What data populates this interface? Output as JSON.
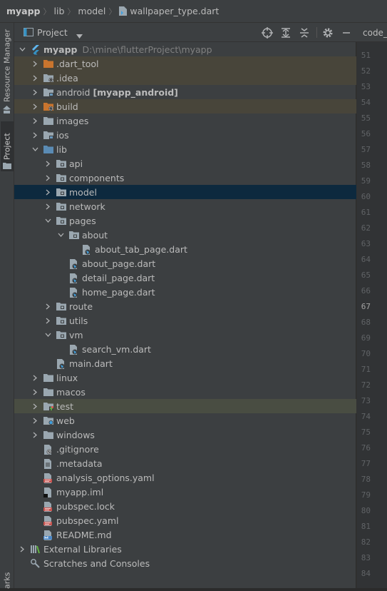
{
  "breadcrumb": {
    "items": [
      "myapp",
      "lib",
      "model",
      "wallpaper_type.dart"
    ]
  },
  "sidebar": {
    "tabs": [
      {
        "label": "Resource Manager"
      },
      {
        "label": "Project"
      },
      {
        "label": "arks"
      }
    ]
  },
  "panel": {
    "title": "Project",
    "icons": [
      "locate-icon",
      "expand-all-icon",
      "collapse-all-icon",
      "gear-icon",
      "minimize-icon"
    ]
  },
  "tree": [
    {
      "label": "myapp",
      "path": "D:\\mine\\flutterProject\\myapp",
      "depth": 0,
      "arrow": "open",
      "icon": "flutter",
      "bold": true
    },
    {
      "label": ".dart_tool",
      "depth": 1,
      "arrow": "closed",
      "icon": "folder-orange",
      "hl": "brown"
    },
    {
      "label": ".idea",
      "depth": 1,
      "arrow": "closed",
      "icon": "folder-gear",
      "hl": "brown"
    },
    {
      "label": "android",
      "suffix": "[myapp_android]",
      "depth": 1,
      "arrow": "closed",
      "icon": "folder-module"
    },
    {
      "label": "build",
      "depth": 1,
      "arrow": "closed",
      "icon": "folder-orange-gear",
      "hl": "brown"
    },
    {
      "label": "images",
      "depth": 1,
      "arrow": "closed",
      "icon": "folder"
    },
    {
      "label": "ios",
      "depth": 1,
      "arrow": "closed",
      "icon": "folder-module"
    },
    {
      "label": "lib",
      "depth": 1,
      "arrow": "open",
      "icon": "folder-blue"
    },
    {
      "label": "api",
      "depth": 2,
      "arrow": "closed",
      "icon": "folder-package"
    },
    {
      "label": "components",
      "depth": 2,
      "arrow": "closed",
      "icon": "folder-package"
    },
    {
      "label": "model",
      "depth": 2,
      "arrow": "closed",
      "icon": "folder-package",
      "hl": "select"
    },
    {
      "label": "network",
      "depth": 2,
      "arrow": "closed",
      "icon": "folder-package"
    },
    {
      "label": "pages",
      "depth": 2,
      "arrow": "open",
      "icon": "folder-package"
    },
    {
      "label": "about",
      "depth": 3,
      "arrow": "open",
      "icon": "folder-package"
    },
    {
      "label": "about_tab_page.dart",
      "depth": 4,
      "arrow": "none",
      "icon": "dart"
    },
    {
      "label": "about_page.dart",
      "depth": 3,
      "arrow": "none",
      "icon": "dart"
    },
    {
      "label": "detail_page.dart",
      "depth": 3,
      "arrow": "none",
      "icon": "dart"
    },
    {
      "label": "home_page.dart",
      "depth": 3,
      "arrow": "none",
      "icon": "dart"
    },
    {
      "label": "route",
      "depth": 2,
      "arrow": "closed",
      "icon": "folder-package"
    },
    {
      "label": "utils",
      "depth": 2,
      "arrow": "closed",
      "icon": "folder-package"
    },
    {
      "label": "vm",
      "depth": 2,
      "arrow": "open",
      "icon": "folder-package"
    },
    {
      "label": "search_vm.dart",
      "depth": 3,
      "arrow": "none",
      "icon": "dart"
    },
    {
      "label": "main.dart",
      "depth": 2,
      "arrow": "none",
      "icon": "dart"
    },
    {
      "label": "linux",
      "depth": 1,
      "arrow": "closed",
      "icon": "folder"
    },
    {
      "label": "macos",
      "depth": 1,
      "arrow": "closed",
      "icon": "folder"
    },
    {
      "label": "test",
      "depth": 1,
      "arrow": "closed",
      "icon": "folder-test",
      "hl": "green"
    },
    {
      "label": "web",
      "depth": 1,
      "arrow": "closed",
      "icon": "folder-web"
    },
    {
      "label": "windows",
      "depth": 1,
      "arrow": "closed",
      "icon": "folder"
    },
    {
      "label": ".gitignore",
      "depth": 1,
      "arrow": "none",
      "icon": "file-ignore"
    },
    {
      "label": ".metadata",
      "depth": 1,
      "arrow": "none",
      "icon": "file-text"
    },
    {
      "label": "analysis_options.yaml",
      "depth": 1,
      "arrow": "none",
      "icon": "file-yaml"
    },
    {
      "label": "myapp.iml",
      "depth": 1,
      "arrow": "none",
      "icon": "file-iml"
    },
    {
      "label": "pubspec.lock",
      "depth": 1,
      "arrow": "none",
      "icon": "file-yaml"
    },
    {
      "label": "pubspec.yaml",
      "depth": 1,
      "arrow": "none",
      "icon": "file-yaml"
    },
    {
      "label": "README.md",
      "depth": 1,
      "arrow": "none",
      "icon": "file-md"
    },
    {
      "label": "External Libraries",
      "depth": 0,
      "arrow": "closed",
      "icon": "libraries"
    },
    {
      "label": "Scratches and Consoles",
      "depth": 0,
      "arrow": "none",
      "icon": "scratches"
    }
  ],
  "editor": {
    "tab_label": "code_",
    "current_line": 67,
    "line_numbers": [
      51,
      52,
      53,
      54,
      55,
      56,
      57,
      58,
      59,
      60,
      61,
      62,
      63,
      64,
      65,
      66,
      67,
      68,
      69,
      70,
      71,
      72,
      73,
      74,
      75,
      76,
      77,
      78,
      79,
      80,
      81,
      82,
      83,
      84
    ]
  },
  "colors": {
    "folder": "#9aa7b0",
    "folder_orange": "#c9752e",
    "folder_blue": "#5a8bb4",
    "selection": "#0d293e",
    "excluded_bg": "#48453a",
    "test_bg": "#494d42",
    "dart_blue": "#40a0e0"
  }
}
